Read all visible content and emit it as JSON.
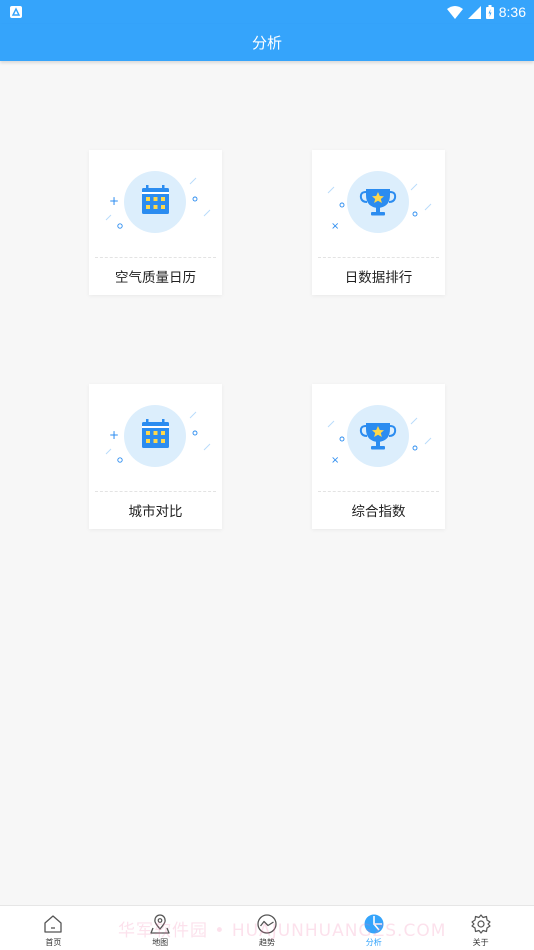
{
  "status_bar": {
    "time": "8:36",
    "icons": [
      "notification-icon",
      "wifi-icon",
      "signal-icon",
      "battery-icon"
    ]
  },
  "app_bar": {
    "title": "分析"
  },
  "cards": [
    {
      "label": "空气质量日历",
      "icon": "calendar-icon"
    },
    {
      "label": "日数据排行",
      "icon": "trophy-icon"
    },
    {
      "label": "城市对比",
      "icon": "calendar-icon"
    },
    {
      "label": "综合指数",
      "icon": "trophy-icon"
    }
  ],
  "bottom_nav": {
    "items": [
      {
        "label": "首页",
        "icon": "home-icon"
      },
      {
        "label": "地图",
        "icon": "map-pin-icon"
      },
      {
        "label": "趋势",
        "icon": "trend-icon"
      },
      {
        "label": "分析",
        "icon": "pie-chart-icon",
        "active": true
      },
      {
        "label": "关于",
        "icon": "gear-icon"
      }
    ]
  },
  "watermark": "华军软件园 • HUAJUNHUANGZS.COM",
  "colors": {
    "primary": "#35a4fb",
    "icon_circle": "#dceefc",
    "icon_blue": "#2b8cf0",
    "icon_yellow": "#ffd84a"
  }
}
